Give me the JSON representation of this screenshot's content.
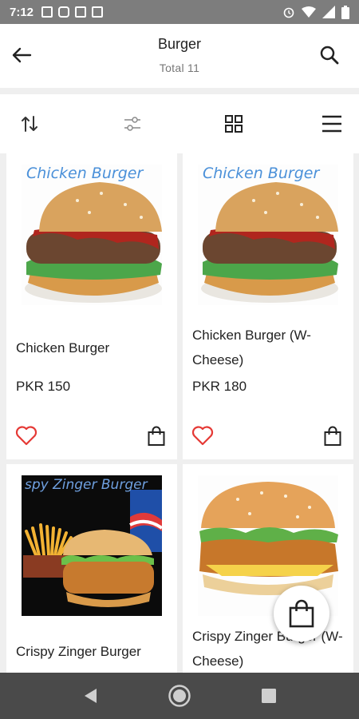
{
  "status_bar": {
    "time": "7:12"
  },
  "header": {
    "title": "Burger",
    "subtitle": "Total 11"
  },
  "toolbar": {
    "sort_icon": "sort-icon",
    "filter_icon": "filter-icon",
    "grid_icon": "grid-view-icon",
    "list_icon": "list-view-icon"
  },
  "products": [
    {
      "name": "Chicken Burger",
      "price": "PKR 150",
      "image_caption": "Chicken Burger"
    },
    {
      "name": "Chicken Burger (W-Cheese)",
      "price": "PKR 180",
      "image_caption": "Chicken Burger"
    },
    {
      "name": "Crispy Zinger Burger",
      "image_caption": "spy Zinger Burger"
    },
    {
      "name": "Crispy Zinger Burger (W-Cheese)"
    }
  ],
  "colors": {
    "accent": "#e53935",
    "status_bar": "#7d7d7d",
    "nav_bar": "#4a4a4a",
    "caption_blue": "#4a90d9"
  }
}
